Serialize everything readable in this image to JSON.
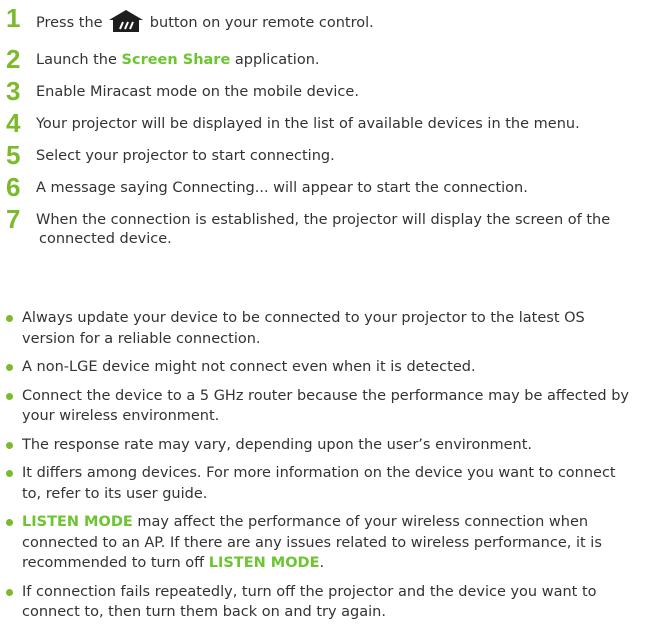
{
  "steps": [
    {
      "num": "1",
      "before": "Press the",
      "after": "button on your remote control.",
      "icon": "home-icon"
    },
    {
      "num": "2",
      "before": "Launch the",
      "highlight": "Screen Share",
      "after": "application."
    },
    {
      "num": "3",
      "text": "Enable Miracast mode on the mobile device."
    },
    {
      "num": "4",
      "text": "Your projector will be displayed in the list of available devices in the menu."
    },
    {
      "num": "5",
      "text": "Select your projector to start connecting."
    },
    {
      "num": "6",
      "text": "A message saying Connecting... will appear to start the connection."
    },
    {
      "num": "7",
      "line1": "When the connection is established, the projector will display the screen of the",
      "line2": "connected device."
    }
  ],
  "notes": [
    {
      "text": "Always update your device to be connected to your projector to the latest OS version for a reliable connection."
    },
    {
      "text": "A non-LGE device might not connect even when it is detected."
    },
    {
      "text": "Connect the device to a 5 GHz router because the performance may be affected by your wireless environment."
    },
    {
      "text": "The response rate may vary, depending upon the user’s environment."
    },
    {
      "text": "It differs among devices. For more information on the device you want to connect to, refer to its user guide."
    },
    {
      "hl1": "LISTEN MODE",
      "mid": " may affect the performance of your wireless connection when connected to an AP. If there are any issues related to wireless performance, it is recommended to turn off ",
      "hl2": "LISTEN MODE",
      "end": "."
    },
    {
      "text": "If connection fails repeatedly, turn off the projector and the device you want to connect to, then turn them back on and try again."
    }
  ],
  "colors": {
    "accent": "#7cba2c",
    "highlight": "#6cc531",
    "text": "#333333",
    "icon": "#1e1e1e"
  }
}
